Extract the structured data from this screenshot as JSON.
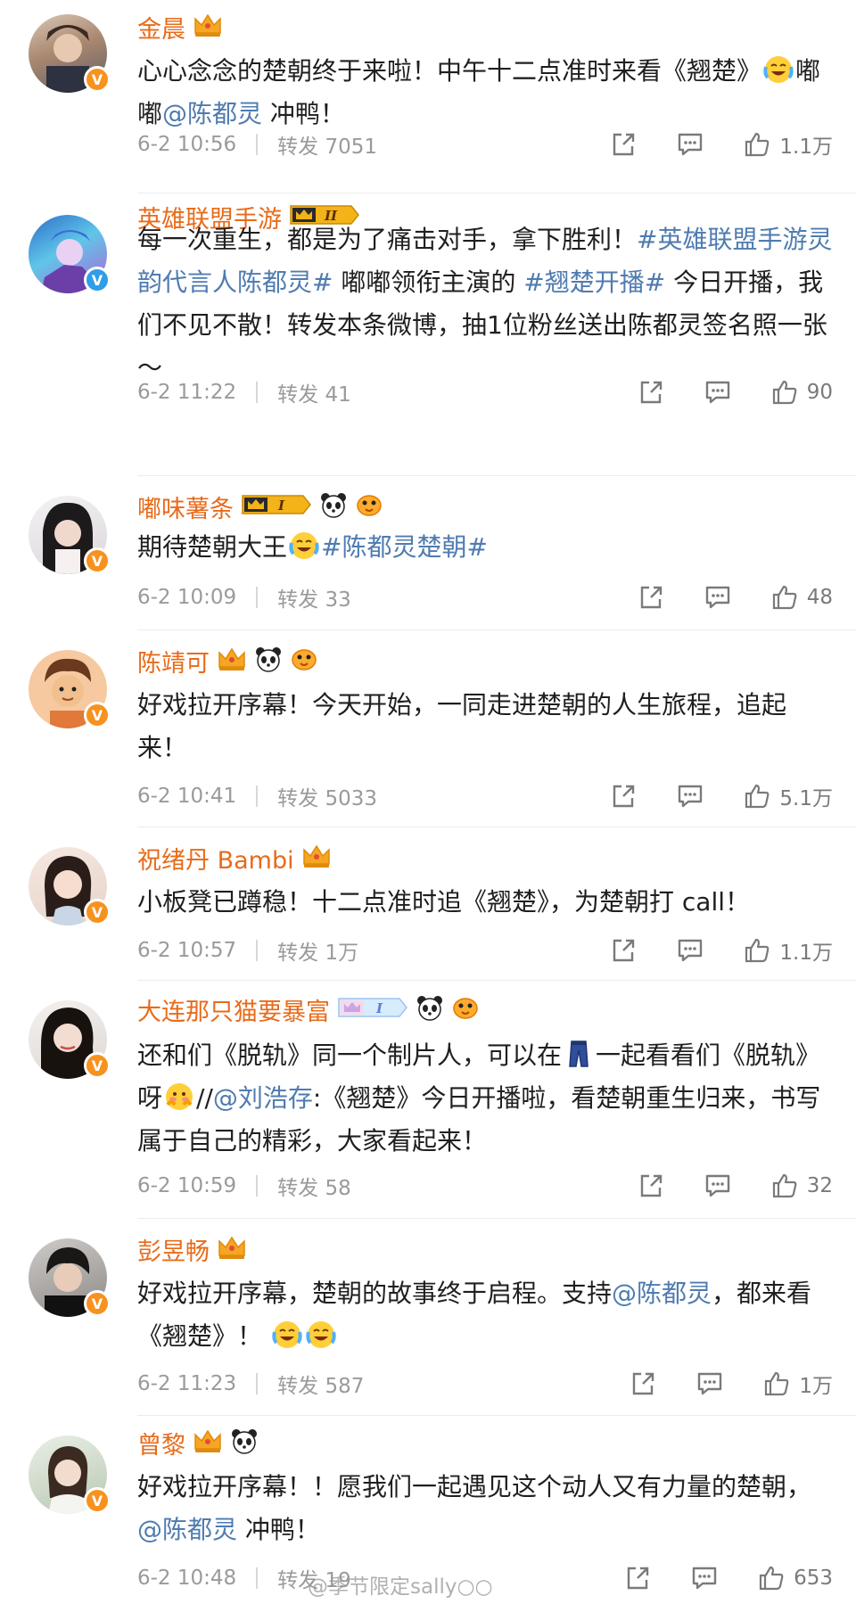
{
  "posts": [
    {
      "name": "金晨",
      "badges": [
        "crown-icon"
      ],
      "text_parts": [
        {
          "t": "心心念念的楚朝终于来啦！中午十二点准时来看《翘楚》"
        },
        {
          "emoji": "crying-laugh-emoji"
        },
        {
          "t": "嘟嘟"
        },
        {
          "link": "@陈都灵"
        },
        {
          "t": " 冲鸭！"
        }
      ],
      "time": "6-2 10:56",
      "forward": "转发 7051",
      "likes": "1.1万",
      "verified": "orange"
    },
    {
      "name": "英雄联盟手游",
      "badges": [
        "level-II-crown-badge"
      ],
      "level_label": "II",
      "text_parts": [
        {
          "t": "每一次重生，都是为了痛击对手，拿下胜利！"
        },
        {
          "link": "#英雄联盟手游灵韵代言人陈都灵#"
        },
        {
          "t": " 嘟嘟领衔主演的 "
        },
        {
          "link": "#翘楚开播#"
        },
        {
          "t": " 今日开播，我们不见不散！转发本条微博，抽1位粉丝送出陈都灵签名照一张～"
        }
      ],
      "time": "6-2 11:22",
      "forward": "转发 41",
      "likes": "90",
      "verified": "blue"
    },
    {
      "name": "嘟味薯条",
      "badges": [
        "level-I-crown-badge",
        "panda-icon",
        "fish-icon"
      ],
      "level_label": "I",
      "text_parts": [
        {
          "t": "期待楚朝大王"
        },
        {
          "emoji": "crying-laugh-emoji"
        },
        {
          "link": "#陈都灵楚朝#"
        }
      ],
      "time": "6-2 10:09",
      "forward": "转发 33",
      "likes": "48",
      "verified": "orange"
    },
    {
      "name": "陈靖可",
      "badges": [
        "crown-icon",
        "panda-icon",
        "fish-icon"
      ],
      "text_parts": [
        {
          "t": "好戏拉开序幕！今天开始，一同走进楚朝的人生旅程，追起来！"
        }
      ],
      "time": "6-2 10:41",
      "forward": "转发 5033",
      "likes": "5.1万",
      "verified": "orange"
    },
    {
      "name": "祝绪丹 Bambi",
      "badges": [
        "crown-icon"
      ],
      "text_parts": [
        {
          "t": "小板凳已蹲稳！十二点准时追《翘楚》，为楚朝打 call！"
        }
      ],
      "time": "6-2 10:57",
      "forward": "转发 1万",
      "likes": "1.1万",
      "verified": "orange"
    },
    {
      "name": "大连那只猫要暴富",
      "badges": [
        "level-I-pastel-badge",
        "panda-icon",
        "fish-icon"
      ],
      "level_label": "I",
      "text_parts": [
        {
          "t": "还和们《脱轨》同一个制片人，可以在"
        },
        {
          "emoji": "jeans-emoji"
        },
        {
          "t": "一起看看们《脱轨》呀"
        },
        {
          "emoji": "shy-emoji"
        },
        {
          "t": "//"
        },
        {
          "link": "@刘浩存"
        },
        {
          "t": ":《翘楚》今日开播啦，看楚朝重生归来，书写属于自己的精彩，大家看起来！"
        }
      ],
      "time": "6-2 10:59",
      "forward": "转发 58",
      "likes": "32",
      "verified": "orange"
    },
    {
      "name": "彭昱畅",
      "badges": [
        "crown-icon"
      ],
      "text_parts": [
        {
          "t": "好戏拉开序幕，楚朝的故事终于启程。支持"
        },
        {
          "link": "@陈都灵"
        },
        {
          "t": "，都来看《翘楚》！ "
        },
        {
          "emoji": "crying-laugh-emoji"
        },
        {
          "emoji": "crying-laugh-emoji"
        }
      ],
      "time": "6-2 11:23",
      "forward": "转发 587",
      "likes": "1万",
      "verified": "orange"
    },
    {
      "name": "曾黎",
      "badges": [
        "crown-icon",
        "panda-icon"
      ],
      "text_parts": [
        {
          "t": "好戏拉开序幕！！愿我们一起遇见这个动人又有力量的楚朝，"
        },
        {
          "link": "@陈都灵"
        },
        {
          "t": " 冲鸭！"
        }
      ],
      "time": "6-2 10:48",
      "forward": "转发 19",
      "likes": "653",
      "verified": "orange"
    }
  ],
  "watermark": "@季节限定sally○○",
  "colors": {
    "name": "#e86b1a",
    "link": "#4f7bb0",
    "meta": "#9a9a9a",
    "verified_orange": "#f7921e",
    "verified_blue": "#2f9de8"
  }
}
